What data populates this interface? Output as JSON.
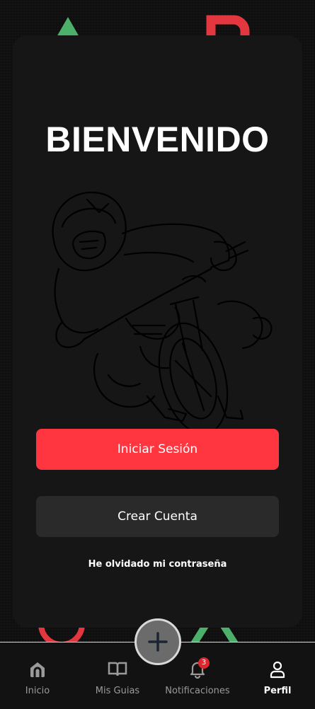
{
  "title": "BIENVENIDO",
  "buttons": {
    "login_label": "Iniciar Sesión",
    "create_label": "Crear Cuenta"
  },
  "forgot_password": "He olvidado mi contraseña",
  "illustration": "motocross-rider-line-drawing",
  "nav": {
    "items": [
      {
        "label": "Inicio",
        "icon": "home-icon"
      },
      {
        "label": "Mis Guias",
        "icon": "book-icon"
      },
      {
        "label": "Notificaciones",
        "icon": "bell-icon",
        "badge": "3"
      },
      {
        "label": "Perfil",
        "icon": "user-icon",
        "active": true
      }
    ],
    "add_icon": "plus-icon"
  },
  "colors": {
    "accent": "#ff3640",
    "card": "#161616",
    "background": "#0f0f0f",
    "secondary_button": "#2a2a2a",
    "decor_green": "#4caf6a",
    "decor_red": "#e2373e"
  }
}
